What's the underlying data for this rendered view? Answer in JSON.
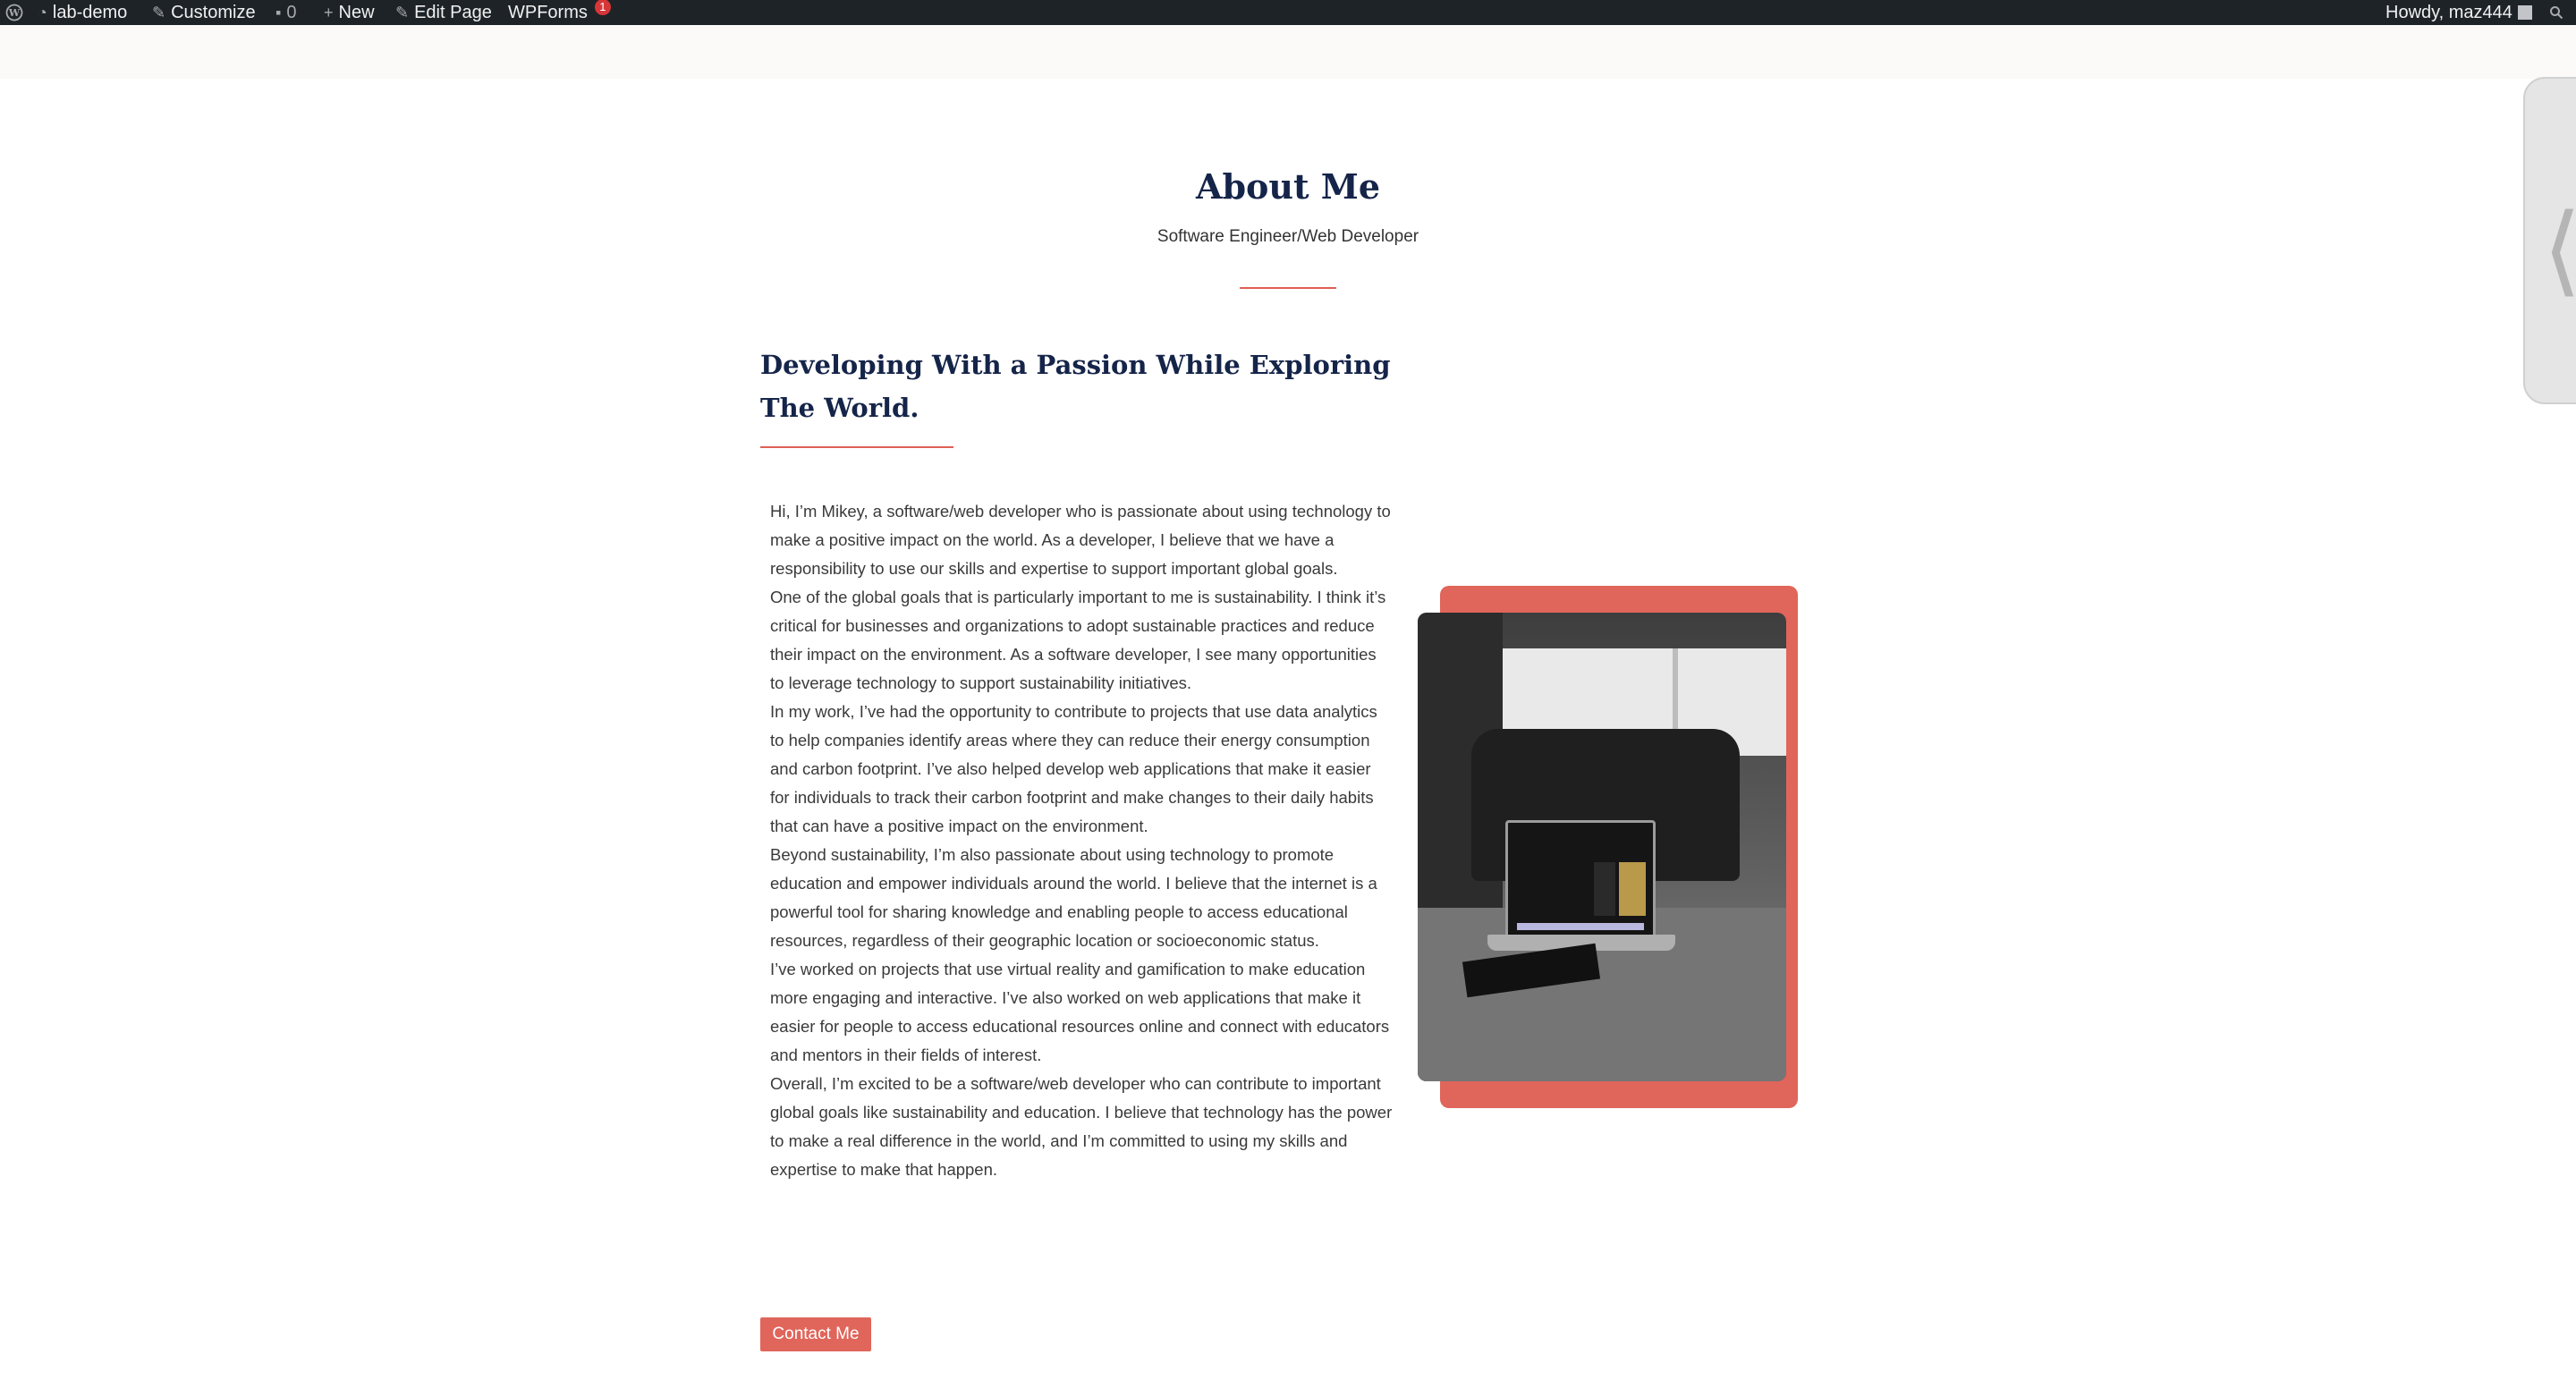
{
  "adminbar": {
    "site_name": "lab-demo",
    "customize": "Customize",
    "comments_count": "0",
    "new": "New",
    "edit_page": "Edit Page",
    "wpforms": "WPForms",
    "wpforms_badge": "1",
    "howdy": "Howdy, maz444"
  },
  "page": {
    "title": "About Me",
    "subtitle": "Software Engineer/Web Developer",
    "heading": "Developing With a Passion While Exploring The World.",
    "paragraphs": [
      "Hi, I’m Mikey, a software/web developer who is passionate about using technology to make a positive impact on the world. As a developer, I believe that we have a responsibility to use our skills and expertise to support important global goals.",
      "One of the global goals that is particularly important to me is sustainability. I think it’s critical for businesses and organizations to adopt sustainable practices and reduce their impact on the environment. As a software developer, I see many opportunities to leverage technology to support sustainability initiatives.",
      "In my work, I’ve had the opportunity to contribute to projects that use data analytics to help companies identify areas where they can reduce their energy consumption and carbon footprint. I’ve also helped develop web applications that make it easier for individuals to track their carbon footprint and make changes to their daily habits that can have a positive impact on the environment.",
      "Beyond sustainability, I’m also passionate about using technology to promote education and empower individuals around the world. I believe that the internet is a powerful tool for sharing knowledge and enabling people to access educational resources, regardless of their geographic location or socioeconomic status.",
      "I’ve worked on projects that use virtual reality and gamification to make education more engaging and interactive. I’ve also worked on web applications that make it easier for people to access educational resources online and connect with educators and mentors in their fields of interest.",
      "Overall, I’m excited to be a software/web developer who can contribute to important global goals like sustainability and education. I believe that technology has the power to make a real difference in the world, and I’m committed to using my skills and expertise to make that happen."
    ],
    "contact_button": "Contact Me"
  },
  "colors": {
    "accent": "#e0655b",
    "heading": "#152449",
    "adminbar": "#1d2327"
  }
}
